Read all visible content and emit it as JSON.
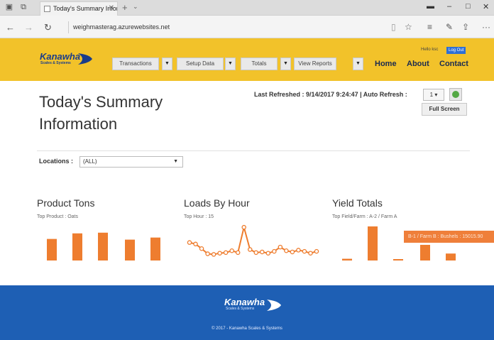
{
  "browser": {
    "tab_title": "Today's Summary Inforr",
    "url": "weighmasterag.azurewebsites.net"
  },
  "header": {
    "logo_text": "Kanawha",
    "logo_sub": "Scales & Systems",
    "menu": [
      {
        "label": "Transactions"
      },
      {
        "label": "Setup Data"
      },
      {
        "label": "Totals"
      },
      {
        "label": "View Reports"
      }
    ],
    "nav_links": [
      "Home",
      "About",
      "Contact"
    ],
    "hello_text": "Hello ksc",
    "logout_label": "Log Out"
  },
  "main": {
    "title": "Today's Summary Information",
    "last_refreshed": "Last Refreshed : 9/14/2017 9:24:47 | Auto Refresh :",
    "auto_refresh_value": "1",
    "fullscreen_label": "Full Screen",
    "locations_label": "Locations :",
    "locations_value": "(ALL)"
  },
  "panels": {
    "product_tons": {
      "title": "Product Tons",
      "subtitle": "Top Product : Oats"
    },
    "loads_by_hour": {
      "title": "Loads By Hour",
      "subtitle": "Top Hour : 15"
    },
    "yield_totals": {
      "title": "Yield Totals",
      "subtitle": "Top Field/Farm : A-2 / Farm A"
    }
  },
  "chart_data": [
    {
      "type": "bar",
      "name": "product_tons",
      "values": [
        0.62,
        0.78,
        0.8,
        0.6,
        0.66
      ],
      "color": "#ee7d2f"
    },
    {
      "type": "line",
      "name": "loads_by_hour",
      "values": [
        0.45,
        0.4,
        0.25,
        0.08,
        0.06,
        0.1,
        0.12,
        0.18,
        0.12,
        0.95,
        0.22,
        0.12,
        0.14,
        0.1,
        0.16,
        0.3,
        0.18,
        0.14,
        0.2,
        0.16,
        0.1,
        0.16
      ],
      "color": "#ee7d2f"
    },
    {
      "type": "bar",
      "name": "yield_totals",
      "values": [
        0.05,
        0.98,
        0.04,
        0.45,
        0.2
      ],
      "color": "#ee7d2f"
    }
  ],
  "tooltip_text": "B-1 / Farm B : Bushels : 15015.90",
  "footer": {
    "logo_text": "Kanawha",
    "logo_sub": "Scales & Systems",
    "copyright": "© 2017 - Kanawha Scales & Systems"
  },
  "colors": {
    "header_bg": "#f2c22a",
    "footer_bg": "#1e5fb4",
    "accent": "#ee7d2f",
    "logout_bg": "#2e6fd6"
  }
}
